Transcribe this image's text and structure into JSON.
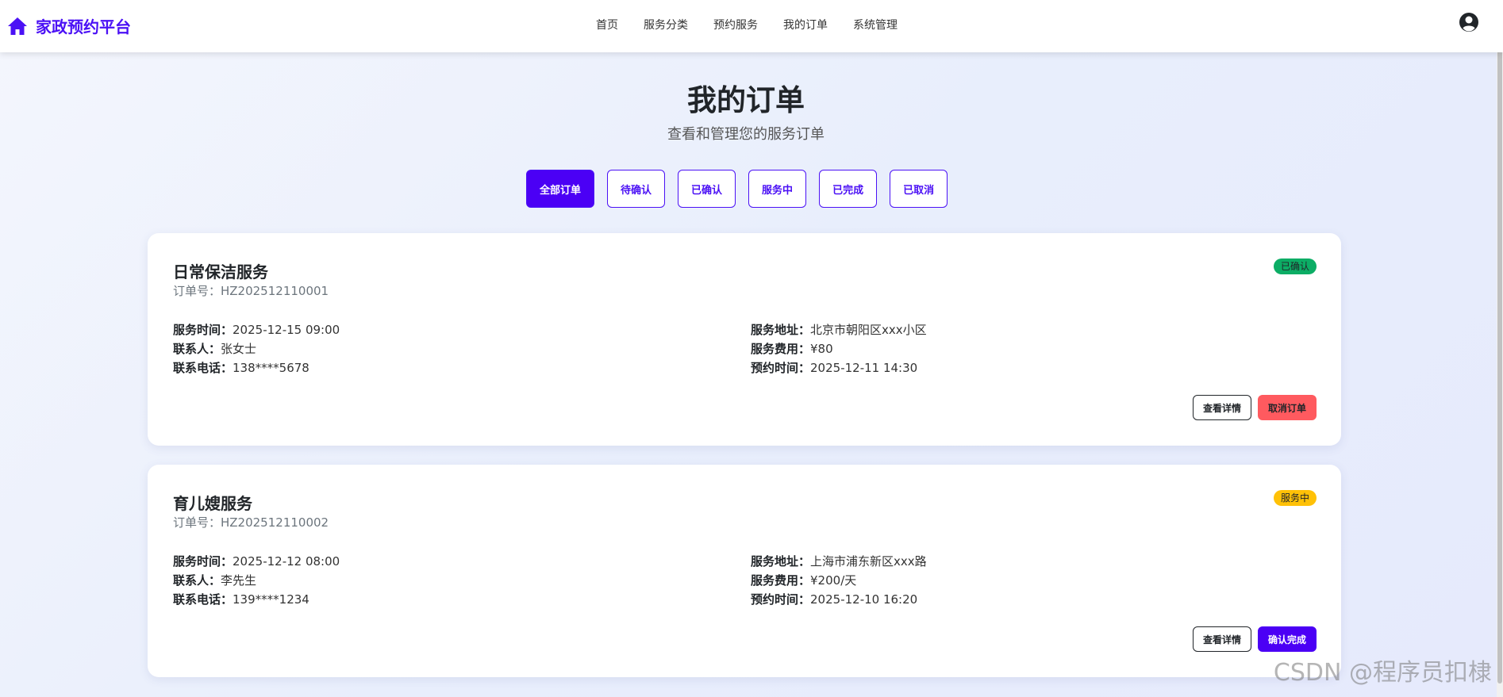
{
  "brand": {
    "name": "家政预约平台",
    "icon": "home-icon"
  },
  "nav": {
    "items": [
      {
        "label": "首页"
      },
      {
        "label": "服务分类"
      },
      {
        "label": "预约服务"
      },
      {
        "label": "我的订单"
      },
      {
        "label": "系统管理"
      }
    ],
    "user_icon": "user-circle-icon"
  },
  "header": {
    "title": "我的订单",
    "subtitle": "查看和管理您的服务订单"
  },
  "filters": [
    {
      "label": "全部订单",
      "active": true
    },
    {
      "label": "待确认",
      "active": false
    },
    {
      "label": "已确认",
      "active": false
    },
    {
      "label": "服务中",
      "active": false
    },
    {
      "label": "已完成",
      "active": false
    },
    {
      "label": "已取消",
      "active": false
    }
  ],
  "orders": [
    {
      "service": "日常保洁服务",
      "order_no": "订单号：HZ202512110001",
      "status": "已确认",
      "status_color": "#0cad65",
      "service_time_label": "服务时间：",
      "service_time": "2025-12-15 09:00",
      "contact_label": "联系人：",
      "contact": "张女士",
      "phone_label": "联系电话：",
      "phone": "138****5678",
      "address_label": "服务地址：",
      "address": "北京市朝阳区xxx小区",
      "fee_label": "服务费用：",
      "fee": "¥80",
      "booked_label": "预约时间：",
      "booked": "2025-12-11 14:30",
      "btn_detail": "查看详情",
      "btn_action": "取消订单"
    },
    {
      "service": "育儿嫂服务",
      "order_no": "订单号：HZ202512110002",
      "status": "服务中",
      "status_color": "#ffc107",
      "service_time_label": "服务时间：",
      "service_time": "2025-12-12 08:00",
      "contact_label": "联系人：",
      "contact": "李先生",
      "phone_label": "联系电话：",
      "phone": "139****1234",
      "address_label": "服务地址：",
      "address": "上海市浦东新区xxx路",
      "fee_label": "服务费用：",
      "fee": "¥200/天",
      "booked_label": "预约时间：",
      "booked": "2025-12-10 16:20",
      "btn_detail": "查看详情",
      "btn_action": "确认完成"
    }
  ],
  "watermark": "CSDN @程序员扣棣"
}
